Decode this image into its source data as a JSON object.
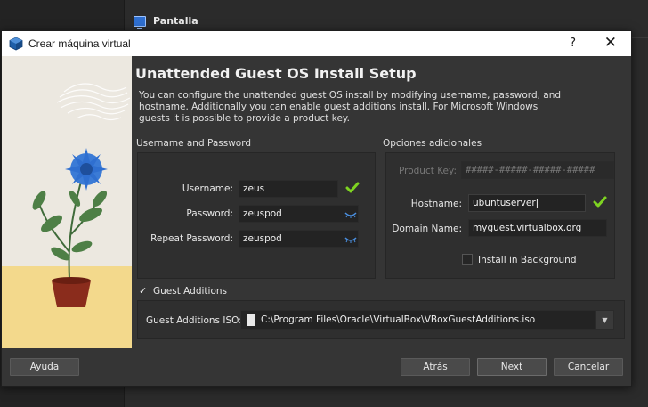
{
  "background": {
    "section_title": "Pantalla",
    "section_icon": "monitor-icon"
  },
  "dialog": {
    "title": "Crear máquina virtual",
    "help_label": "?",
    "close_label": "✕",
    "heading": "Unattended Guest OS Install Setup",
    "description": "You can configure the unattended guest OS install by modifying username, password, and hostname. Additionally you can enable guest additions install. For Microsoft Windows guests it is possible to provide a product key."
  },
  "user_group": {
    "label": "Username and Password",
    "username_label": "Username:",
    "username_value": "zeus",
    "password_label": "Password:",
    "password_value": "zeuspod",
    "repeat_label": "Repeat Password:",
    "repeat_value": "zeuspod"
  },
  "extra_group": {
    "label": "Opciones adicionales",
    "product_key_label": "Product Key:",
    "product_key_placeholder": "#####-#####-#####-#####",
    "hostname_label": "Hostname:",
    "hostname_value": "ubuntuserver",
    "domain_label": "Domain Name:",
    "domain_value": "myguest.virtualbox.org",
    "install_bg_label": "Install in Background",
    "install_bg_checked": false
  },
  "guest_additions": {
    "label": "Guest Additions",
    "checked": true,
    "iso_label": "Guest Additions ISO:",
    "iso_path": "C:\\Program Files\\Oracle\\VirtualBox\\VBoxGuestAdditions.iso"
  },
  "buttons": {
    "help": "Ayuda",
    "back": "Atrás",
    "next": "Next",
    "cancel": "Cancelar"
  },
  "colors": {
    "check_ok": "#7ed321",
    "eye": "#4a8fe0",
    "flower": "#2f6fd0"
  }
}
